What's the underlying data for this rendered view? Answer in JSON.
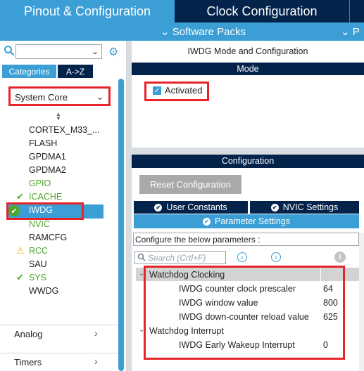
{
  "top_tabs": {
    "pinout": "Pinout & Configuration",
    "clock": "Clock Configuration"
  },
  "subbar": {
    "software_packs": "Software Packs",
    "overflow": "P"
  },
  "left": {
    "categories_label": "Categories",
    "az_label": "A->Z",
    "system_core_label": "System Core",
    "items": [
      {
        "label": "CORTEX_M33_...",
        "status": ""
      },
      {
        "label": "FLASH",
        "status": ""
      },
      {
        "label": "GPDMA1",
        "status": ""
      },
      {
        "label": "GPDMA2",
        "status": ""
      },
      {
        "label": "GPIO",
        "status": "green"
      },
      {
        "label": "ICACHE",
        "status": "check"
      },
      {
        "label": "IWDG",
        "status": "selected"
      },
      {
        "label": "NVIC",
        "status": "green"
      },
      {
        "label": "RAMCFG",
        "status": ""
      },
      {
        "label": "RCC",
        "status": "warning"
      },
      {
        "label": "SAU",
        "status": ""
      },
      {
        "label": "SYS",
        "status": "check"
      },
      {
        "label": "WWDG",
        "status": ""
      }
    ],
    "analog_label": "Analog",
    "timers_label": "Timers"
  },
  "right": {
    "mode_title": "IWDG Mode and Configuration",
    "mode_header": "Mode",
    "activated_label": "Activated",
    "activated_checked": true,
    "config_header": "Configuration",
    "reset_button": "Reset Configuration",
    "tab_user_constants": "User Constants",
    "tab_nvic": "NVIC Settings",
    "tab_parameters": "Parameter Settings",
    "configure_label": "Configure the below parameters :",
    "search_placeholder": "Search (Crtl+F)",
    "groups": [
      {
        "name": "Watchdog Clocking",
        "params": [
          {
            "name": "IWDG counter clock prescaler",
            "value": "64"
          },
          {
            "name": "IWDG window value",
            "value": "800"
          },
          {
            "name": "IWDG down-counter reload value",
            "value": "625"
          }
        ]
      },
      {
        "name": "Watchdog Interrupt",
        "params": [
          {
            "name": "IWDG Early Wakeup Interrupt",
            "value": "0"
          }
        ]
      }
    ]
  },
  "colors": {
    "dark_navy": "#03234b",
    "accent_blue": "#3b9fd6",
    "status_green": "#4ea62a",
    "warning_yellow": "#e7b300",
    "highlight_red": "#e8242b"
  }
}
